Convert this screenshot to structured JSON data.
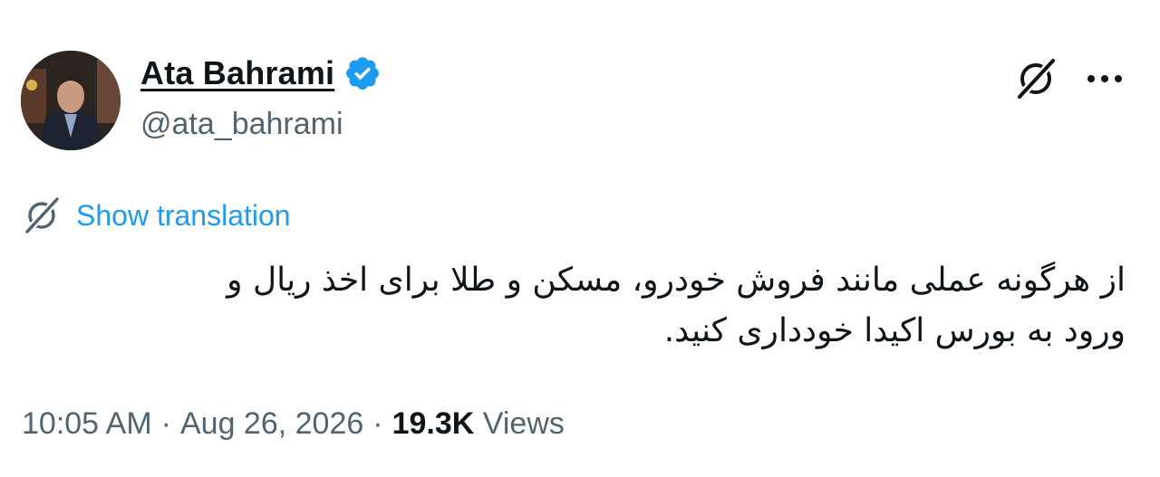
{
  "author": {
    "display_name": "Ata Bahrami",
    "handle": "@ata_bahrami"
  },
  "icons": {
    "verified": "verified-badge-icon",
    "grok": "grok-icon",
    "more": "more-icon",
    "translate": "translate-icon"
  },
  "translation": {
    "label": "Show translation"
  },
  "tweet": {
    "text": "از هرگونه عملی مانند فروش خودرو، مسکن و طلا برای اخذ ریال و\nورود به بورس اکیدا خودداری کنید."
  },
  "meta": {
    "time": "10:05 AM",
    "separator": "·",
    "date": "Aug 26, 2026",
    "views_count": "19.3K",
    "views_label": "Views"
  },
  "colors": {
    "link": "#1d9bf0",
    "secondary_text": "#536471",
    "primary_text": "#0f1419",
    "verified": "#1d9bf0"
  }
}
